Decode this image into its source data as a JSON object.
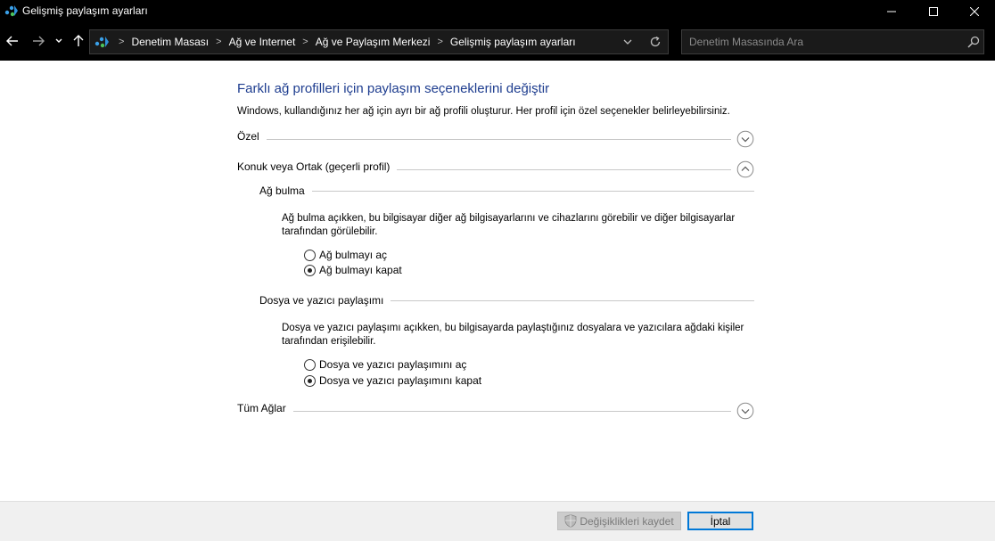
{
  "window": {
    "title": "Gelişmiş paylaşım ayarları"
  },
  "nav": {
    "breadcrumbs": [
      "Denetim Masası",
      "Ağ ve Internet",
      "Ağ ve Paylaşım Merkezi",
      "Gelişmiş paylaşım ayarları"
    ],
    "search_placeholder": "Denetim Masasında Ara"
  },
  "page": {
    "title": "Farklı ağ profilleri için paylaşım seçeneklerini değiştir",
    "description": "Windows, kullandığınız her ağ için ayrı bir ağ profili oluşturur. Her profil için özel seçenekler belirleyebilirsiniz."
  },
  "profiles": {
    "private": {
      "label": "Özel",
      "state": "collapsed"
    },
    "guest": {
      "label": "Konuk veya Ortak (geçerli profil)",
      "state": "expanded",
      "network_discovery": {
        "heading": "Ağ bulma",
        "description": "Ağ bulma açıkken, bu bilgisayar diğer ağ bilgisayarlarını ve cihazlarını görebilir ve diğer bilgisayarlar tarafından görülebilir.",
        "option_on": "Ağ bulmayı aç",
        "option_off": "Ağ bulmayı kapat",
        "selected": "off"
      },
      "file_printer_sharing": {
        "heading": "Dosya ve yazıcı paylaşımı",
        "description": "Dosya ve yazıcı paylaşımı açıkken, bu bilgisayarda paylaştığınız dosyalara ve yazıcılara ağdaki kişiler tarafından erişilebilir.",
        "option_on": "Dosya ve yazıcı paylaşımını aç",
        "option_off": "Dosya ve yazıcı paylaşımını kapat",
        "selected": "off"
      }
    },
    "all_networks": {
      "label": "Tüm Ağlar",
      "state": "collapsed"
    }
  },
  "footer": {
    "save_label": "Değişiklikleri kaydet",
    "cancel_label": "İptal"
  },
  "colors": {
    "title_blue": "#1e3d8f",
    "focus_blue": "#0078d7"
  }
}
